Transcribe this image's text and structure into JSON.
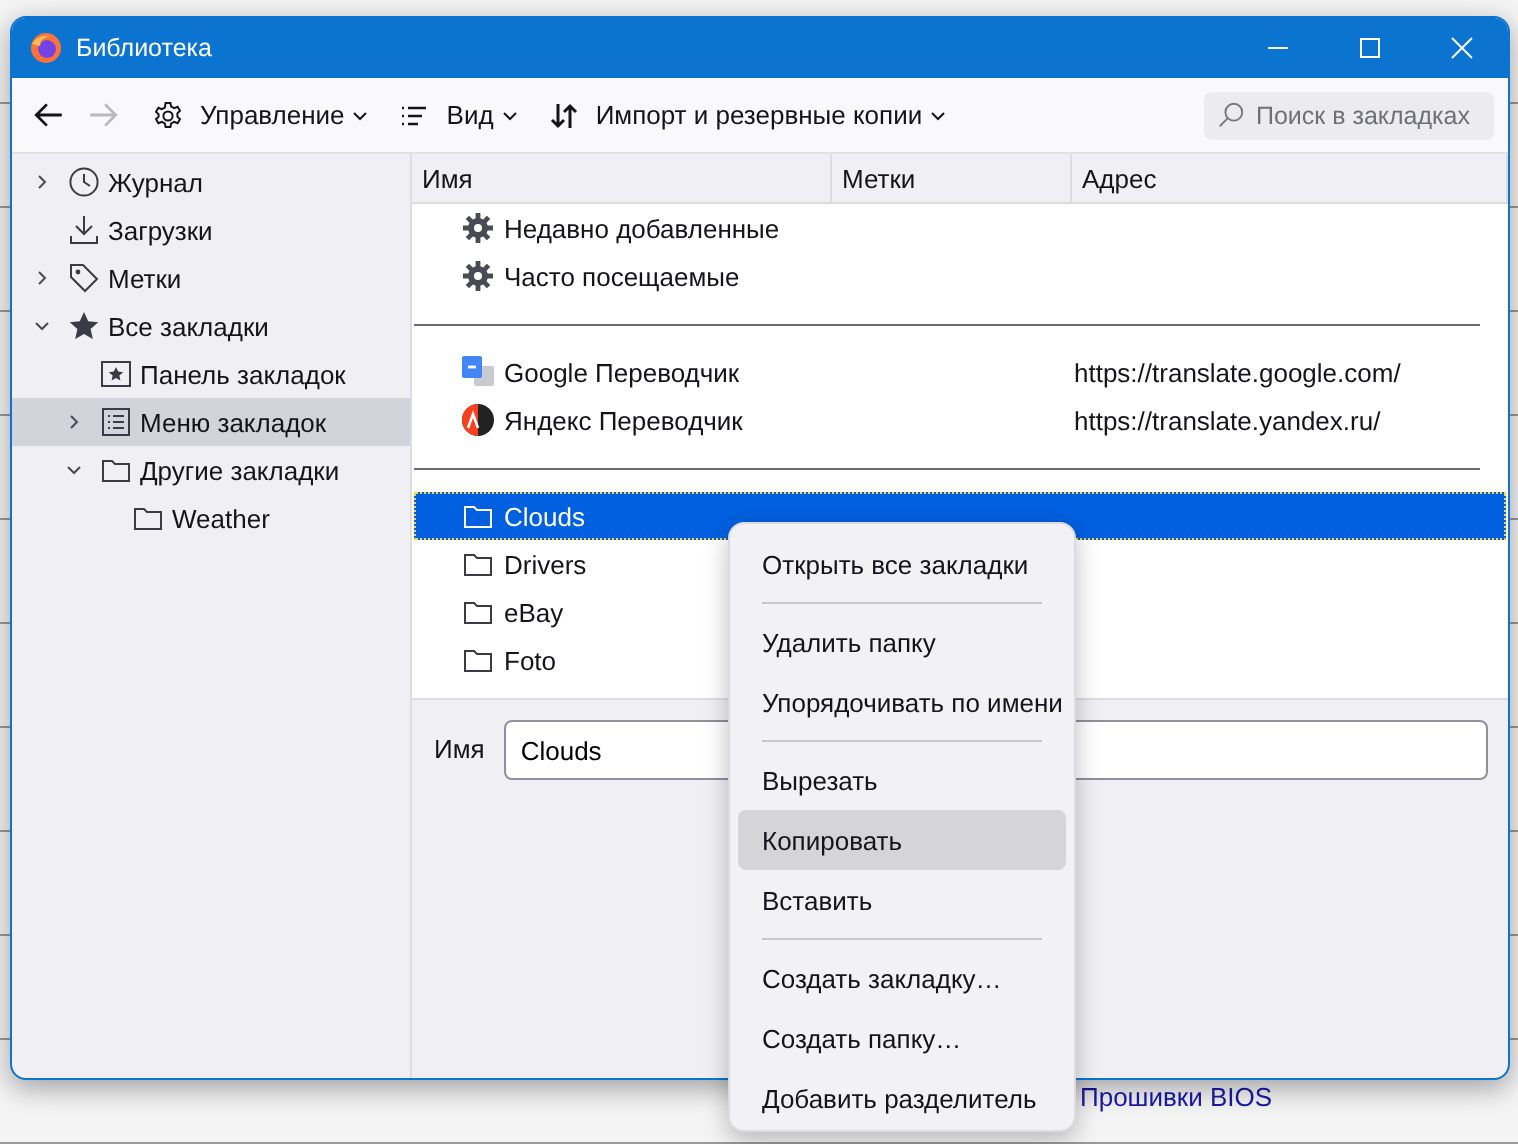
{
  "background_texts": [
    "Прошивки BIOS"
  ],
  "window": {
    "title": "Библиотека"
  },
  "toolbar": {
    "back": {
      "disabled": false
    },
    "forward": {
      "disabled": true
    },
    "menus": [
      {
        "label": "Управление"
      },
      {
        "label": "Вид"
      },
      {
        "label": "Импорт и резервные копии"
      }
    ],
    "search": {
      "placeholder": "Поиск в закладках"
    }
  },
  "sidebar": [
    {
      "label": "Журнал",
      "kind": "history",
      "expanded": false,
      "selected": false,
      "expandable": true
    },
    {
      "label": "Загрузки",
      "kind": "downloads",
      "selected": false,
      "expandable": false
    },
    {
      "label": "Метки",
      "kind": "tags",
      "expanded": false,
      "selected": false,
      "expandable": true
    },
    {
      "label": "Все закладки",
      "kind": "library",
      "expanded": true,
      "selected": false,
      "expandable": true,
      "children": [
        {
          "label": "Панель закладок",
          "kind": "toolbar",
          "selected": false,
          "expandable": false
        },
        {
          "label": "Меню закладок",
          "kind": "menu",
          "expanded": false,
          "selected": true,
          "expandable": true
        },
        {
          "label": "Другие закладки",
          "kind": "folder",
          "expanded": true,
          "selected": false,
          "expandable": true,
          "children": [
            {
              "label": "Weather",
              "kind": "folder",
              "selected": false,
              "expandable": false
            }
          ]
        }
      ]
    }
  ],
  "table": {
    "columns": [
      "Имя",
      "Метки",
      "Адрес"
    ],
    "rows": [
      {
        "kind": "query",
        "name": "Недавно добавленные",
        "selected": false
      },
      {
        "kind": "query",
        "name": "Часто посещаемые",
        "selected": false
      },
      {
        "kind": "separator",
        "selected": false
      },
      {
        "kind": "bookmark",
        "name": "Google Переводчик",
        "address": "https://translate.google.com/",
        "selected": false
      },
      {
        "kind": "bookmark",
        "name": "Яндекс Переводчик",
        "address": "https://translate.yandex.ru/",
        "selected": false
      },
      {
        "kind": "separator",
        "selected": false
      },
      {
        "kind": "folder",
        "name": "Clouds",
        "selected": true
      },
      {
        "kind": "folder",
        "name": "Drivers",
        "selected": false
      },
      {
        "kind": "folder",
        "name": "eBay",
        "selected": false
      },
      {
        "kind": "folder",
        "name": "Foto",
        "selected": false
      }
    ]
  },
  "details": {
    "label": "Имя",
    "value": "Clouds"
  },
  "context_menu": [
    {
      "kind": "item",
      "label": "Открыть все закладки",
      "highlighted": false
    },
    {
      "kind": "separator"
    },
    {
      "kind": "item",
      "label": "Удалить папку",
      "highlighted": false
    },
    {
      "kind": "item",
      "label": "Упорядочивать по имени",
      "highlighted": false
    },
    {
      "kind": "separator"
    },
    {
      "kind": "item",
      "label": "Вырезать",
      "highlighted": false
    },
    {
      "kind": "item",
      "label": "Копировать",
      "highlighted": true
    },
    {
      "kind": "item",
      "label": "Вставить",
      "highlighted": false
    },
    {
      "kind": "separator"
    },
    {
      "kind": "item",
      "label": "Создать закладку…",
      "highlighted": false
    },
    {
      "kind": "item",
      "label": "Создать папку…",
      "highlighted": false
    },
    {
      "kind": "item",
      "label": "Добавить разделитель",
      "highlighted": false
    }
  ]
}
